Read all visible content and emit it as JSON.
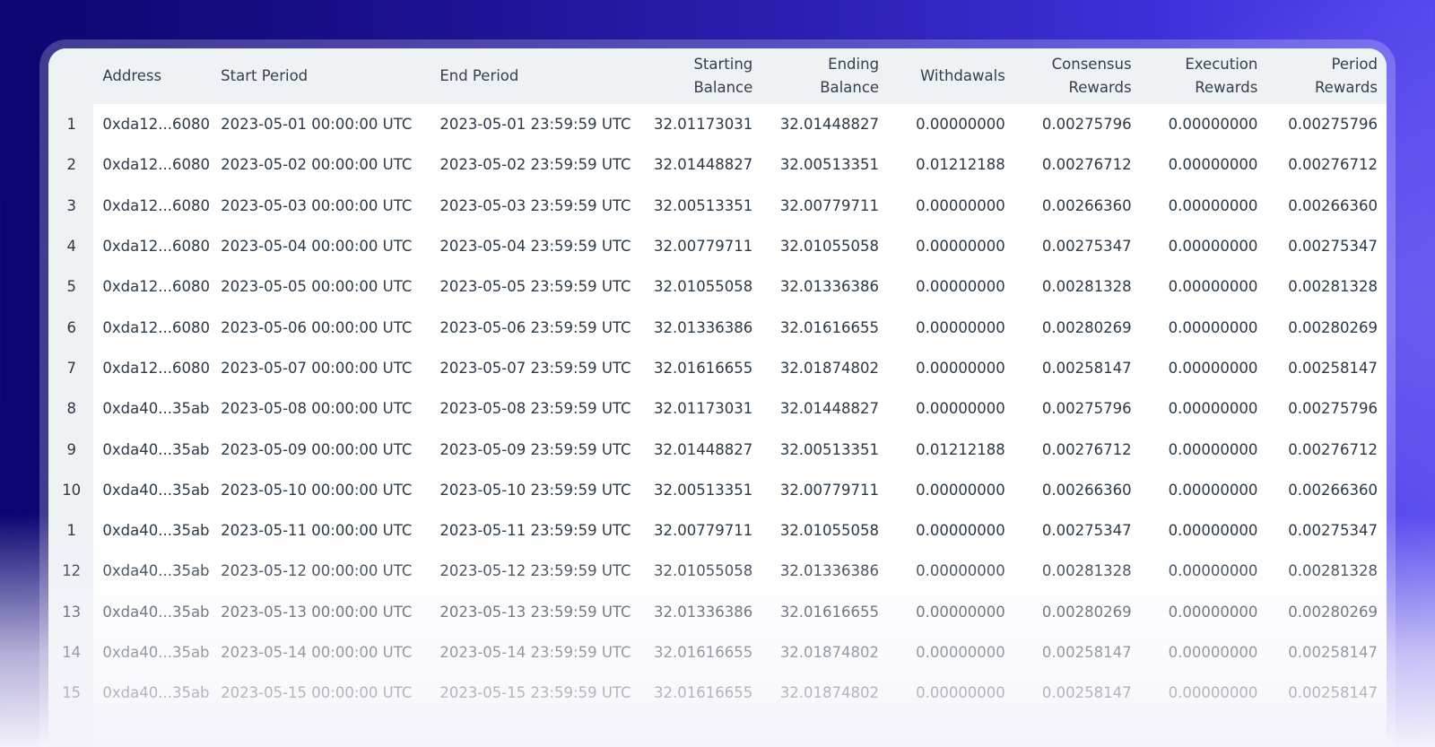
{
  "table": {
    "columns": {
      "address": "Address",
      "start_period": "Start Period",
      "end_period": "End Period",
      "starting_balance_1": "Starting",
      "starting_balance_2": "Balance",
      "ending_balance_1": "Ending",
      "ending_balance_2": "Balance",
      "withdrawals": "Withdawals",
      "consensus_rewards_1": "Consensus",
      "consensus_rewards_2": "Rewards",
      "execution_rewards_1": "Execution",
      "execution_rewards_2": "Rewards",
      "period_rewards_1": "Period",
      "period_rewards_2": "Rewards"
    },
    "rows": [
      {
        "num": "1",
        "address": "0xda12...6080",
        "start": "2023-05-01 00:00:00 UTC",
        "end": "2023-05-01 23:59:59 UTC",
        "starting": "32.01173031",
        "ending": "32.01448827",
        "withdrawals": "0.00000000",
        "consensus": "0.00275796",
        "execution": "0.00000000",
        "period": "0.00275796"
      },
      {
        "num": "2",
        "address": "0xda12...6080",
        "start": "2023-05-02 00:00:00 UTC",
        "end": "2023-05-02 23:59:59 UTC",
        "starting": "32.01448827",
        "ending": "32.00513351",
        "withdrawals": "0.01212188",
        "consensus": "0.00276712",
        "execution": "0.00000000",
        "period": "0.00276712"
      },
      {
        "num": "3",
        "address": "0xda12...6080",
        "start": "2023-05-03 00:00:00 UTC",
        "end": "2023-05-03 23:59:59 UTC",
        "starting": "32.00513351",
        "ending": "32.00779711",
        "withdrawals": "0.00000000",
        "consensus": "0.00266360",
        "execution": "0.00000000",
        "period": "0.00266360"
      },
      {
        "num": "4",
        "address": "0xda12...6080",
        "start": "2023-05-04 00:00:00 UTC",
        "end": "2023-05-04 23:59:59 UTC",
        "starting": "32.00779711",
        "ending": "32.01055058",
        "withdrawals": "0.00000000",
        "consensus": "0.00275347",
        "execution": "0.00000000",
        "period": "0.00275347"
      },
      {
        "num": "5",
        "address": "0xda12...6080",
        "start": "2023-05-05 00:00:00 UTC",
        "end": "2023-05-05 23:59:59 UTC",
        "starting": "32.01055058",
        "ending": "32.01336386",
        "withdrawals": "0.00000000",
        "consensus": "0.00281328",
        "execution": "0.00000000",
        "period": "0.00281328"
      },
      {
        "num": "6",
        "address": "0xda12...6080",
        "start": "2023-05-06 00:00:00 UTC",
        "end": "2023-05-06 23:59:59 UTC",
        "starting": "32.01336386",
        "ending": "32.01616655",
        "withdrawals": "0.00000000",
        "consensus": "0.00280269",
        "execution": "0.00000000",
        "period": "0.00280269"
      },
      {
        "num": "7",
        "address": "0xda12...6080",
        "start": "2023-05-07 00:00:00 UTC",
        "end": "2023-05-07 23:59:59 UTC",
        "starting": "32.01616655",
        "ending": "32.01874802",
        "withdrawals": "0.00000000",
        "consensus": "0.00258147",
        "execution": "0.00000000",
        "period": "0.00258147"
      },
      {
        "num": "8",
        "address": "0xda40...35ab",
        "start": "2023-05-08 00:00:00 UTC",
        "end": "2023-05-08 23:59:59 UTC",
        "starting": "32.01173031",
        "ending": "32.01448827",
        "withdrawals": "0.00000000",
        "consensus": "0.00275796",
        "execution": "0.00000000",
        "period": "0.00275796"
      },
      {
        "num": "9",
        "address": "0xda40...35ab",
        "start": "2023-05-09 00:00:00 UTC",
        "end": "2023-05-09 23:59:59 UTC",
        "starting": "32.01448827",
        "ending": "32.00513351",
        "withdrawals": "0.01212188",
        "consensus": "0.00276712",
        "execution": "0.00000000",
        "period": "0.00276712"
      },
      {
        "num": "10",
        "address": "0xda40...35ab",
        "start": "2023-05-10 00:00:00 UTC",
        "end": "2023-05-10 23:59:59 UTC",
        "starting": "32.00513351",
        "ending": "32.00779711",
        "withdrawals": "0.00000000",
        "consensus": "0.00266360",
        "execution": "0.00000000",
        "period": "0.00266360"
      },
      {
        "num": "1",
        "address": "0xda40...35ab",
        "start": "2023-05-11 00:00:00 UTC",
        "end": "2023-05-11 23:59:59 UTC",
        "starting": "32.00779711",
        "ending": "32.01055058",
        "withdrawals": "0.00000000",
        "consensus": "0.00275347",
        "execution": "0.00000000",
        "period": "0.00275347"
      },
      {
        "num": "12",
        "address": "0xda40...35ab",
        "start": "2023-05-12 00:00:00 UTC",
        "end": "2023-05-12 23:59:59 UTC",
        "starting": "32.01055058",
        "ending": "32.01336386",
        "withdrawals": "0.00000000",
        "consensus": "0.00281328",
        "execution": "0.00000000",
        "period": "0.00281328"
      },
      {
        "num": "13",
        "address": "0xda40...35ab",
        "start": "2023-05-13 00:00:00 UTC",
        "end": "2023-05-13 23:59:59 UTC",
        "starting": "32.01336386",
        "ending": "32.01616655",
        "withdrawals": "0.00000000",
        "consensus": "0.00280269",
        "execution": "0.00000000",
        "period": "0.00280269"
      },
      {
        "num": "14",
        "address": "0xda40...35ab",
        "start": "2023-05-14 00:00:00 UTC",
        "end": "2023-05-14 23:59:59 UTC",
        "starting": "32.01616655",
        "ending": "32.01874802",
        "withdrawals": "0.00000000",
        "consensus": "0.00258147",
        "execution": "0.00000000",
        "period": "0.00258147"
      },
      {
        "num": "15",
        "address": "0xda40...35ab",
        "start": "2023-05-15 00:00:00 UTC",
        "end": "2023-05-15 23:59:59 UTC",
        "starting": "32.01616655",
        "ending": "32.01874802",
        "withdrawals": "0.00000000",
        "consensus": "0.00258147",
        "execution": "0.00000000",
        "period": "0.00258147"
      }
    ]
  },
  "colors": {
    "background_dark": "#0b0570",
    "background_light": "#5548ee",
    "header_bg": "#eef2f5",
    "text": "#2c3947"
  }
}
